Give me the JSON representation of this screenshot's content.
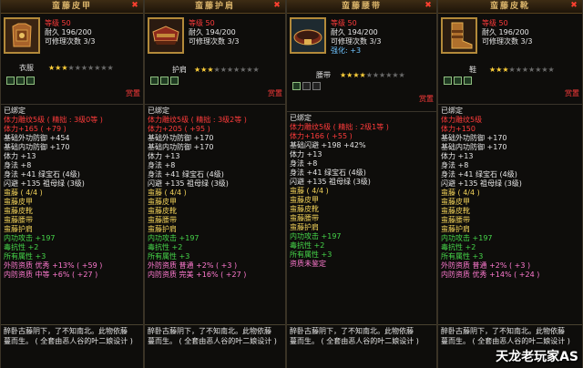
{
  "panels": [
    {
      "title": "蛮藤皮甲",
      "close": "✖",
      "level": "等级 50",
      "durability": "耐久 196/200",
      "repair": "可修理次数 3/3",
      "slot": "衣服",
      "stars_filled": 3,
      "stars_total": 10,
      "gems_filled": 3,
      "price_label": "赏置",
      "bound": "已绑定",
      "lines": [
        {
          "t": "体力雕纹5级 ( 精拙 : 3级0等 )",
          "c": "red"
        },
        {
          "t": "体力+165 ( +79 )",
          "c": "red"
        },
        {
          "t": "基础外功防御 +454",
          "c": "white"
        },
        {
          "t": "基础内功防御 +170",
          "c": "white"
        },
        {
          "t": "体力 +13",
          "c": "white"
        },
        {
          "t": "身法 +8",
          "c": "white"
        },
        {
          "t": "身法 +41  绿宝石 (4级)",
          "c": "white"
        },
        {
          "t": "闪避 +135  祖母绿 (3级)",
          "c": "white"
        },
        {
          "t": "蛮藤  ( 4/4 )",
          "c": "yellow"
        },
        {
          "t": "蛮藤皮甲",
          "c": "yellow"
        },
        {
          "t": "蛮藤皮靴",
          "c": "yellow"
        },
        {
          "t": "蛮藤腰带",
          "c": "yellow"
        },
        {
          "t": "蛮藤护肩",
          "c": "yellow"
        },
        {
          "t": "内功攻击 +197",
          "c": "green"
        },
        {
          "t": "毒抗性 +2",
          "c": "green"
        },
        {
          "t": "所有属性 +3",
          "c": "green"
        },
        {
          "t": "外防资质   优秀  +13% ( +59 )",
          "c": "pink"
        },
        {
          "t": "内防资质   中等  +6% ( +27 )",
          "c": "pink"
        }
      ],
      "flavor1": "醉卧古藤阴下，了不知南北。此物依藤",
      "flavor2": "蔓而生。 ( 全套由恶人谷的叶二娘设计 )"
    },
    {
      "title": "蛮藤护肩",
      "close": "✖",
      "level": "等级 50",
      "durability": "耐久 194/200",
      "repair": "可修理次数 3/3",
      "slot": "护肩",
      "stars_filled": 3,
      "stars_total": 10,
      "gems_filled": 3,
      "price_label": "赏置",
      "bound": "已绑定",
      "lines": [
        {
          "t": "体力雕纹5级 ( 精拙 : 3级2等 )",
          "c": "red"
        },
        {
          "t": "体力+205 ( +95 )",
          "c": "red"
        },
        {
          "t": "基础外功防御 +170",
          "c": "white"
        },
        {
          "t": "基础内功防御 +170",
          "c": "white"
        },
        {
          "t": "体力 +13",
          "c": "white"
        },
        {
          "t": "身法 +8",
          "c": "white"
        },
        {
          "t": "身法 +41  绿宝石 (4级)",
          "c": "white"
        },
        {
          "t": "闪避 +135  祖母绿 (3级)",
          "c": "white"
        },
        {
          "t": "蛮藤  ( 4/4 )",
          "c": "yellow"
        },
        {
          "t": "蛮藤皮甲",
          "c": "yellow"
        },
        {
          "t": "蛮藤皮靴",
          "c": "yellow"
        },
        {
          "t": "蛮藤腰带",
          "c": "yellow"
        },
        {
          "t": "蛮藤护肩",
          "c": "yellow"
        },
        {
          "t": "内功攻击 +197",
          "c": "green"
        },
        {
          "t": "毒抗性 +2",
          "c": "green"
        },
        {
          "t": "所有属性 +3",
          "c": "green"
        },
        {
          "t": "外防资质   普通  +2% ( +3 )",
          "c": "pink"
        },
        {
          "t": "内防资质   完美  +16% ( +27 )",
          "c": "pink"
        }
      ],
      "flavor1": "醉卧古藤阴下，了不知南北。此物依藤",
      "flavor2": "蔓而生。 ( 全套由恶人谷的叶二娘设计 )"
    },
    {
      "title": "蛮藤腰带",
      "close": "✖",
      "level": "等级 50",
      "durability": "耐久 194/200",
      "repair": "可修理次数 3/3",
      "enhance": "强化: +3",
      "slot": "腰带",
      "stars_filled": 4,
      "stars_total": 10,
      "gems_filled": 1,
      "price_label": "赏置",
      "bound": "已绑定",
      "lines": [
        {
          "t": "体力雕纹5级 ( 精拙 : 2级1等 )",
          "c": "red"
        },
        {
          "t": "体力+166 ( +55 )",
          "c": "red"
        },
        {
          "t": "基础闪避 +198  +42%",
          "c": "white"
        },
        {
          "t": "体力 +13",
          "c": "white"
        },
        {
          "t": "身法 +8",
          "c": "white"
        },
        {
          "t": "身法 +41  绿宝石 (4级)",
          "c": "white"
        },
        {
          "t": "闪避 +135  祖母绿 (3级)",
          "c": "white"
        },
        {
          "t": "蛮藤  ( 4/4 )",
          "c": "yellow"
        },
        {
          "t": "蛮藤皮甲",
          "c": "yellow"
        },
        {
          "t": "蛮藤皮靴",
          "c": "yellow"
        },
        {
          "t": "蛮藤腰带",
          "c": "yellow"
        },
        {
          "t": "蛮藤护肩",
          "c": "yellow"
        },
        {
          "t": "内功攻击 +197",
          "c": "green"
        },
        {
          "t": "毒抗性 +2",
          "c": "green"
        },
        {
          "t": "所有属性 +3",
          "c": "green"
        },
        {
          "t": "资质未鉴定",
          "c": "pink"
        }
      ],
      "flavor1": "醉卧古藤阴下，了不知南北。此物依藤",
      "flavor2": "蔓而生。 ( 全套由恶人谷的叶二娘设计 )"
    },
    {
      "title": "蛮藤皮靴",
      "close": "✖",
      "level": "等级 50",
      "durability": "耐久 196/200",
      "repair": "可修理次数 3/3",
      "slot": "鞋",
      "stars_filled": 3,
      "stars_total": 10,
      "gems_filled": 3,
      "price_label": "赏置",
      "bound": "已绑定",
      "lines": [
        {
          "t": "体力雕纹5级",
          "c": "red"
        },
        {
          "t": "体力+150",
          "c": "red"
        },
        {
          "t": "基础外功防御 +170",
          "c": "white"
        },
        {
          "t": "基础内功防御 +170",
          "c": "white"
        },
        {
          "t": "体力 +13",
          "c": "white"
        },
        {
          "t": "身法 +8",
          "c": "white"
        },
        {
          "t": "身法 +41  绿宝石 (4级)",
          "c": "white"
        },
        {
          "t": "闪避 +135  祖母绿 (3级)",
          "c": "white"
        },
        {
          "t": "蛮藤  ( 4/4 )",
          "c": "yellow"
        },
        {
          "t": "蛮藤皮甲",
          "c": "yellow"
        },
        {
          "t": "蛮藤皮靴",
          "c": "yellow"
        },
        {
          "t": "蛮藤腰带",
          "c": "yellow"
        },
        {
          "t": "蛮藤护肩",
          "c": "yellow"
        },
        {
          "t": "内功攻击 +197",
          "c": "green"
        },
        {
          "t": "毒抗性 +2",
          "c": "green"
        },
        {
          "t": "所有属性 +3",
          "c": "green"
        },
        {
          "t": "外防资质   普通  +2% ( +3 )",
          "c": "pink"
        },
        {
          "t": "内防资质   优秀  +14% ( +24 )",
          "c": "pink"
        }
      ],
      "flavor1": "醉卧古藤阴下，了不知南北。此物依藤",
      "flavor2": "蔓而生。 ( 全套由恶人谷的叶二娘设计 )"
    }
  ],
  "watermark": "天龙老玩家AS",
  "colors": {
    "title_gold": "#d9b36a",
    "red": "#ff3b3b",
    "yellow": "#f2d25a",
    "green": "#46d64a",
    "pink": "#ff7ad0"
  }
}
